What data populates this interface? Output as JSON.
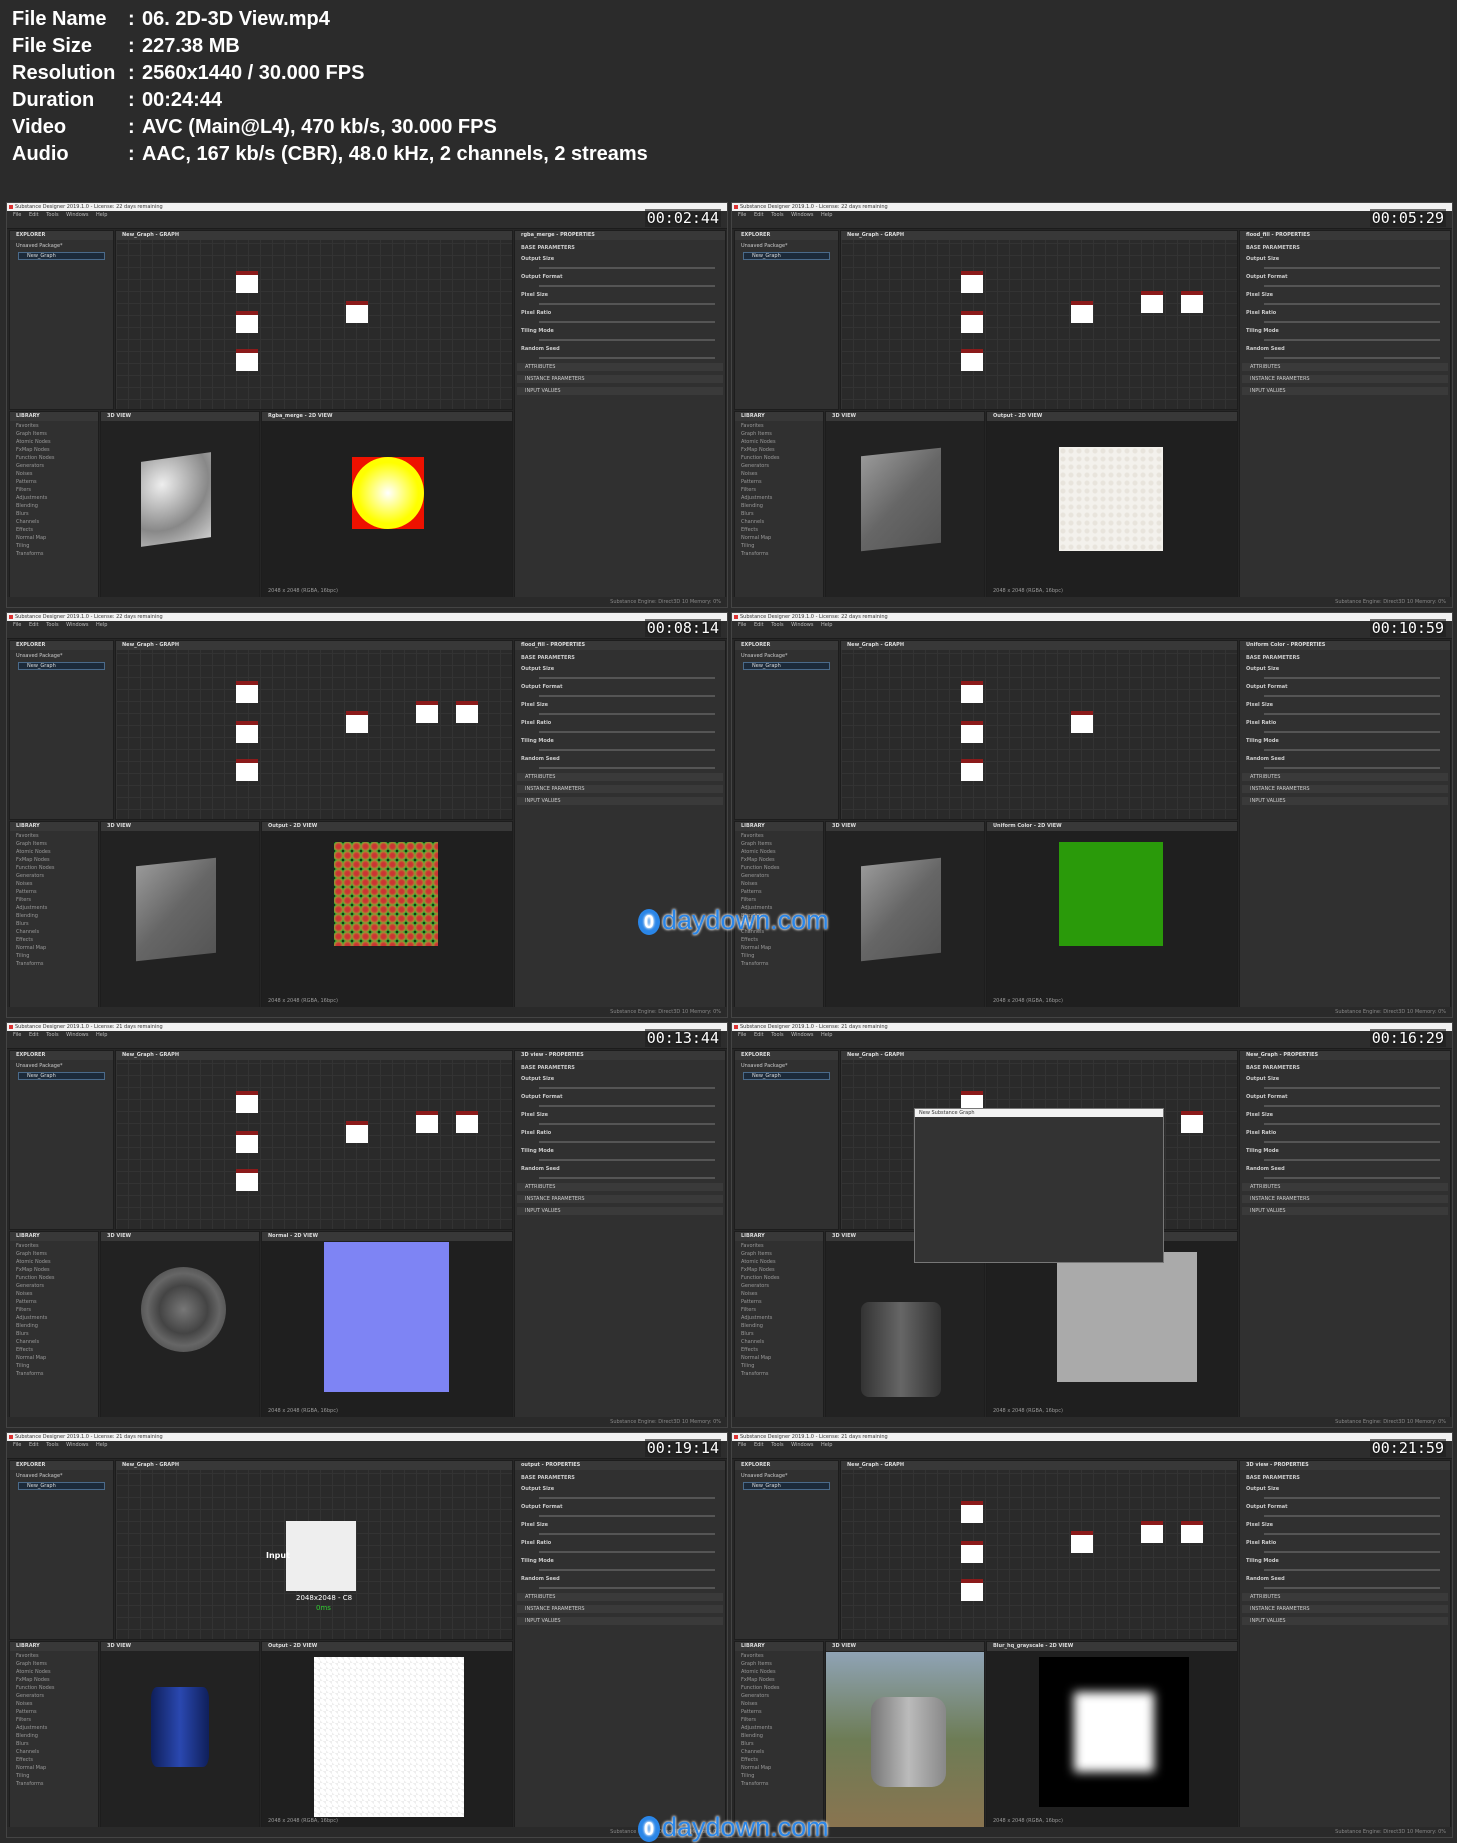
{
  "info": [
    {
      "label": "File Name",
      "value": "06. 2D-3D View.mp4"
    },
    {
      "label": "File Size",
      "value": "227.38 MB"
    },
    {
      "label": "Resolution",
      "value": "2560x1440 / 30.000 FPS"
    },
    {
      "label": "Duration",
      "value": "00:24:44"
    },
    {
      "label": "Video",
      "value": "AVC (Main@L4), 470 kb/s, 30.000 FPS"
    },
    {
      "label": "Audio",
      "value": "AAC, 167 kb/s (CBR), 48.0 kHz, 2 channels, 2 streams"
    }
  ],
  "separator": ":",
  "app": {
    "menu": "File Edit Tools Windows Help",
    "explorer": "EXPLORER",
    "package": "Unsaved Package*",
    "graph_item": "New_Graph",
    "library": "LIBRARY",
    "view3d": "3D VIEW",
    "lib_items": [
      "Favorites",
      "Graph Items",
      "Atomic Nodes",
      "FxMap Nodes",
      "Function Nodes",
      "Generators",
      "Noises",
      "Patterns",
      "Filters",
      "Adjustments",
      "Blending",
      "Blurs",
      "Channels",
      "Effects",
      "Normal Map",
      "Tiling",
      "Transforms"
    ],
    "prop_rows": [
      "BASE PARAMETERS",
      "Output Size",
      "Output Format",
      "Pixel Size",
      "Pixel Ratio",
      "Tiling Mode",
      "Random Seed"
    ],
    "prop_sections": [
      "ATTRIBUTES",
      "INSTANCE PARAMETERS",
      "INPUT VALUES"
    ],
    "status": "Substance Engine: Direct3D 10  Memory: 0%",
    "resolution_label": "2048 x 2048 (RGBA, 16bpc)"
  },
  "thumbs": [
    {
      "time": "00:02:44",
      "title": "Substance Designer 2019.1.0 - License: 22 days remaining",
      "graph": "New_Graph - GRAPH",
      "props": "rgba_merge - PROPERTIES",
      "view2d": "Rgba_merge - 2D VIEW",
      "v3": "marble",
      "v2": "yellow"
    },
    {
      "time": "00:05:29",
      "title": "Substance Designer 2019.1.0 - License: 22 days remaining",
      "graph": "New_Graph - GRAPH",
      "props": "flood_fill - PROPERTIES",
      "view2d": "Output - 2D VIEW",
      "v3": "grey",
      "v2": "cells"
    },
    {
      "time": "00:08:14",
      "title": "Substance Designer 2019.1.0 - License: 22 days remaining",
      "graph": "New_Graph - GRAPH",
      "props": "flood_fill - PROPERTIES",
      "view2d": "Output - 2D VIEW",
      "v3": "grey",
      "v2": "voronoi"
    },
    {
      "time": "00:10:59",
      "title": "Substance Designer 2019.1.0 - License: 22 days remaining",
      "graph": "New_Graph - GRAPH",
      "props": "Uniform Color - PROPERTIES",
      "view2d": "Uniform Color - 2D VIEW",
      "v3": "grey",
      "v2": "green"
    },
    {
      "time": "00:13:44",
      "title": "Substance Designer 2019.1.0 - License: 21 days remaining",
      "graph": "New_Graph - GRAPH",
      "props": "3D view - PROPERTIES",
      "view2d": "Normal - 2D VIEW",
      "v3": "disc",
      "v2": "normal"
    },
    {
      "time": "00:16:29",
      "title": "Substance Designer 2019.1.0 - License: 21 days remaining",
      "graph": "New_Graph - GRAPH",
      "props": "New_Graph - PROPERTIES",
      "view2d": "Output - 2D VIEW",
      "v3": "mesh",
      "v2": "grey",
      "dialog": "New Substance Graph"
    },
    {
      "time": "00:19:14",
      "title": "Substance Designer 2019.1.0 - License: 21 days remaining",
      "graph": "New_Graph - GRAPH",
      "props": "output - PROPERTIES",
      "view2d": "Output - 2D VIEW",
      "v3": "cylinder",
      "v2": "checker",
      "node_label": "Input",
      "node_info": "2048x2048 - C8",
      "node_time": "0ms"
    },
    {
      "time": "00:21:59",
      "title": "Substance Designer 2019.1.0 - License: 21 days remaining",
      "graph": "New_Graph - GRAPH",
      "props": "3D view - PROPERTIES",
      "view2d": "Blur_hq_grayscale - 2D VIEW",
      "v3": "env",
      "v2": "blur"
    }
  ],
  "watermark": "daydown.com",
  "watermark_icon": "0"
}
